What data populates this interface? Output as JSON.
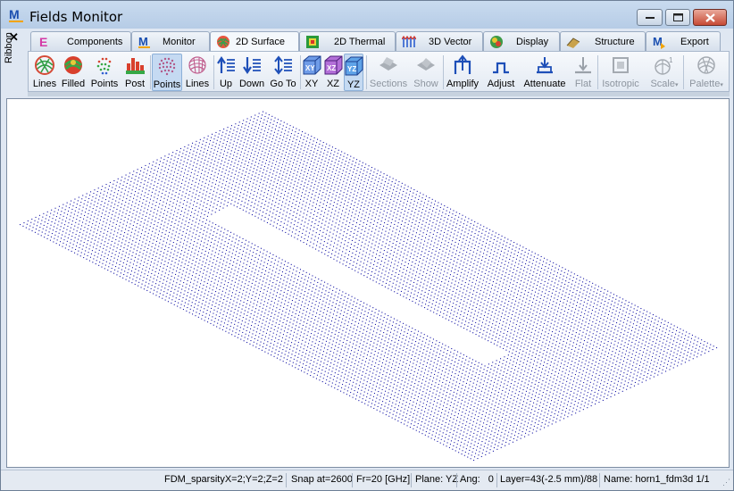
{
  "window": {
    "title": "Fields Monitor",
    "app_icon": "M-logo-icon",
    "controls": [
      "minimize-icon",
      "maximize-icon",
      "close-icon"
    ]
  },
  "ribbon": {
    "side_label": "Ribbon",
    "close_glyph": "✕"
  },
  "tabs": [
    {
      "label": "Components",
      "icon": "component-E-icon",
      "active": false
    },
    {
      "label": "Monitor",
      "icon": "M-logo-icon",
      "active": false
    },
    {
      "label": "2D Surface",
      "icon": "surface-mesh-icon",
      "active": true
    },
    {
      "label": "2D Thermal",
      "icon": "thermal-map-icon",
      "active": false
    },
    {
      "label": "3D Vector",
      "icon": "vector-field-icon",
      "active": false
    },
    {
      "label": "Display",
      "icon": "display-sphere-icon",
      "active": false
    },
    {
      "label": "Structure",
      "icon": "structure-icon",
      "active": false
    },
    {
      "label": "Export",
      "icon": "export-icon",
      "active": false
    }
  ],
  "toolbar": {
    "groups": [
      {
        "name": "mode",
        "items": [
          {
            "label": "Lines",
            "icon": "lines-mesh-icon"
          },
          {
            "label": "Filled",
            "icon": "filled-mesh-icon"
          },
          {
            "label": "Points",
            "icon": "points-mesh-icon"
          },
          {
            "label": "Post",
            "icon": "post-bars-icon"
          }
        ]
      },
      {
        "name": "display",
        "items": [
          {
            "label": "Points",
            "icon": "points-surface-icon",
            "selected": true
          },
          {
            "label": "Lines",
            "icon": "lines-surface-icon"
          }
        ]
      },
      {
        "name": "navigate",
        "items": [
          {
            "label": "Up",
            "icon": "layer-up-icon"
          },
          {
            "label": "Down",
            "icon": "layer-down-icon"
          },
          {
            "label": "Go To",
            "icon": "layer-goto-icon"
          }
        ]
      },
      {
        "name": "plane",
        "items": [
          {
            "label": "XY",
            "icon": "plane-xy-icon"
          },
          {
            "label": "XZ",
            "icon": "plane-xz-icon"
          },
          {
            "label": "YZ",
            "icon": "plane-yz-icon",
            "selected": true
          }
        ]
      },
      {
        "name": "sections",
        "items": [
          {
            "label": "Sections",
            "icon": "sections-icon",
            "disabled": true
          },
          {
            "label": "Show",
            "icon": "show-icon",
            "disabled": true
          }
        ]
      },
      {
        "name": "amplitude",
        "items": [
          {
            "label": "Amplify",
            "icon": "amplify-icon"
          },
          {
            "label": "Adjust",
            "icon": "adjust-icon"
          },
          {
            "label": "Attenuate",
            "icon": "attenuate-icon"
          },
          {
            "label": "Flat",
            "icon": "flat-icon",
            "disabled": true
          }
        ]
      },
      {
        "name": "scale",
        "items": [
          {
            "label": "Isotropic",
            "icon": "isotropic-icon",
            "disabled": true
          },
          {
            "label": "Scale",
            "icon": "scale-icon",
            "disabled": true,
            "dropdown": true
          },
          {
            "label": "Palette",
            "icon": "palette-icon",
            "disabled": true,
            "dropdown": true
          }
        ]
      }
    ]
  },
  "status_bar": {
    "fields": [
      "FDM_sparsityX=2;Y=2;Z=2",
      "Snap at=2600",
      "Fr=20 [GHz]",
      "Plane: YZ",
      "Ang:   0",
      "Layer=43(-2.5 mm)/88",
      "Name: horn1_fdm3d 1/1"
    ]
  },
  "colors": {
    "point_color": "#1a1aa8",
    "title_bar": "#c0d5ec",
    "background": "#dfe7f2"
  }
}
